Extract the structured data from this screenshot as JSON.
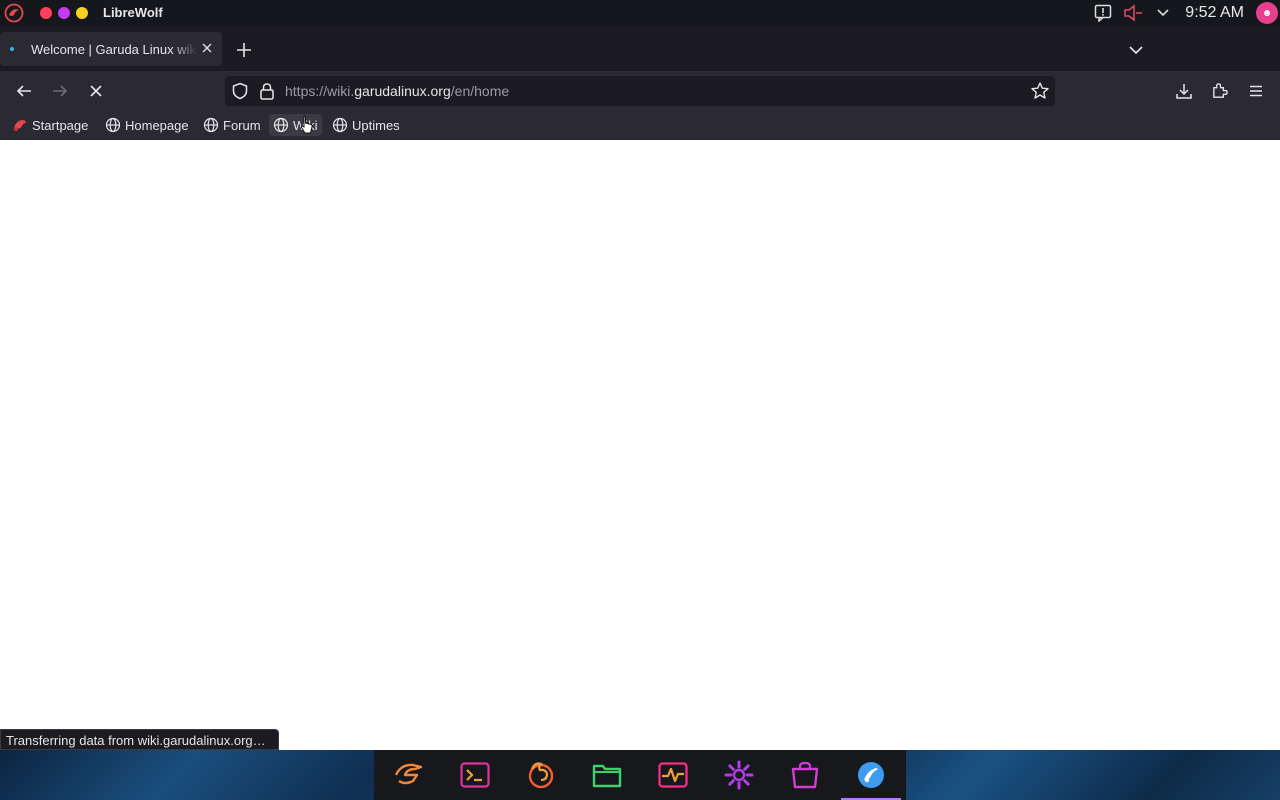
{
  "system": {
    "app_name": "LibreWolf",
    "clock": "9:52 AM",
    "window_dots": [
      "#ff4058",
      "#c43bf0",
      "#f5d21f"
    ]
  },
  "tabs": [
    {
      "title": "Welcome | Garuda Linux wiki",
      "active": true
    }
  ],
  "navbar": {
    "url_scheme": "https://wiki.",
    "url_host": "garudalinux.org",
    "url_path": "/en/home"
  },
  "bookmarks": [
    {
      "label": "Startpage",
      "icon": "librewolf-icon"
    },
    {
      "label": "Homepage",
      "icon": "globe-icon"
    },
    {
      "label": "Forum",
      "icon": "globe-icon"
    },
    {
      "label": "Wiki",
      "icon": "globe-icon"
    },
    {
      "label": "Uptimes",
      "icon": "globe-icon"
    }
  ],
  "status_text": "Transferring data from wiki.garudalinux.org…",
  "dock": {
    "items": [
      {
        "name": "garuda-icon",
        "color": "#f0883a"
      },
      {
        "name": "terminal-icon",
        "color": "#e0339b"
      },
      {
        "name": "firefox-icon",
        "color": "#f45d2c"
      },
      {
        "name": "files-icon",
        "color": "#3fd06a"
      },
      {
        "name": "system-monitor-icon",
        "color": "#ff2d8a"
      },
      {
        "name": "settings-icon",
        "color": "#b13ce8"
      },
      {
        "name": "store-icon",
        "color": "#d23bd6"
      },
      {
        "name": "librewolf-browser-icon",
        "color": "#3d9cf0"
      }
    ],
    "active_accent": "#b07dff"
  }
}
